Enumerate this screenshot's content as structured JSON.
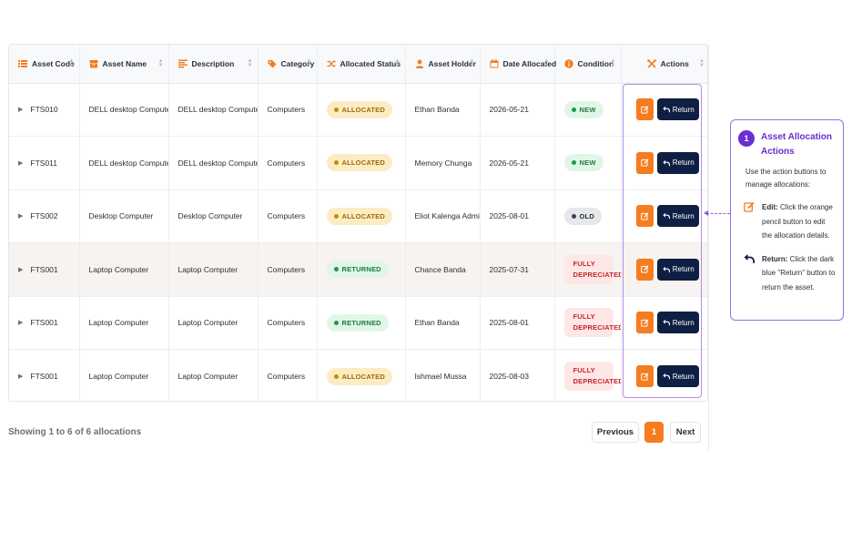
{
  "columns": [
    {
      "label": "Asset Code",
      "icon": "list-icon"
    },
    {
      "label": "Asset Name",
      "icon": "box-icon"
    },
    {
      "label": "Description",
      "icon": "text-lines-icon"
    },
    {
      "label": "Category",
      "icon": "tag-icon"
    },
    {
      "label": "Allocated Status",
      "icon": "shuffle-icon"
    },
    {
      "label": "Asset Holder",
      "icon": "user-icon"
    },
    {
      "label": "Date Allocated",
      "icon": "calendar-icon"
    },
    {
      "label": "Condition",
      "icon": "info-circle-icon"
    },
    {
      "label": "Actions",
      "icon": "tools-icon"
    }
  ],
  "rows": [
    {
      "code": "FTS010",
      "name": "DELL desktop Computer",
      "description": "DELL desktop Computer",
      "category": "Computers",
      "status": "ALLOCATED",
      "holder": "Ethan Banda",
      "date": "2026-05-21",
      "condition": "NEW"
    },
    {
      "code": "FTS011",
      "name": "DELL desktop Computer",
      "description": "DELL desktop Computer",
      "category": "Computers",
      "status": "ALLOCATED",
      "holder": "Memory Chunga",
      "date": "2026-05-21",
      "condition": "NEW"
    },
    {
      "code": "FTS002",
      "name": "Desktop Computer",
      "description": "Desktop Computer",
      "category": "Computers",
      "status": "ALLOCATED",
      "holder": "Eliot Kalenga Admin",
      "date": "2025-08-01",
      "condition": "OLD"
    },
    {
      "code": "FTS001",
      "name": "Laptop Computer",
      "description": "Laptop Computer",
      "category": "Computers",
      "status": "RETURNED",
      "holder": "Chance Banda",
      "date": "2025-07-31",
      "condition": "FULLY DEPRECIATED"
    },
    {
      "code": "FTS001",
      "name": "Laptop Computer",
      "description": "Laptop Computer",
      "category": "Computers",
      "status": "RETURNED",
      "holder": "Ethan Banda",
      "date": "2025-08-01",
      "condition": "FULLY DEPRECIATED"
    },
    {
      "code": "FTS001",
      "name": "Laptop Computer",
      "description": "Laptop Computer",
      "category": "Computers",
      "status": "ALLOCATED",
      "holder": "Ishmael Mussa",
      "date": "2025-08-03",
      "condition": "FULLY DEPRECIATED"
    }
  ],
  "return_label": "Return",
  "footer": {
    "info": "Showing 1 to 6 of 6 allocations",
    "previous": "Previous",
    "current_page": "1",
    "next": "Next"
  },
  "tip": {
    "number": "1",
    "title": "Asset Allocation Actions",
    "intro": "Use the action buttons to manage allocations:",
    "edit_label": "Edit:",
    "edit_text": " Click the orange pencil button to edit the allocation details.",
    "return_label": "Return:",
    "return_text": " Click the dark blue \"Return\" button to return the asset."
  },
  "colors": {
    "accent_orange": "#f57c1f",
    "navy": "#0f1f43",
    "purple": "#6b2fd1"
  }
}
